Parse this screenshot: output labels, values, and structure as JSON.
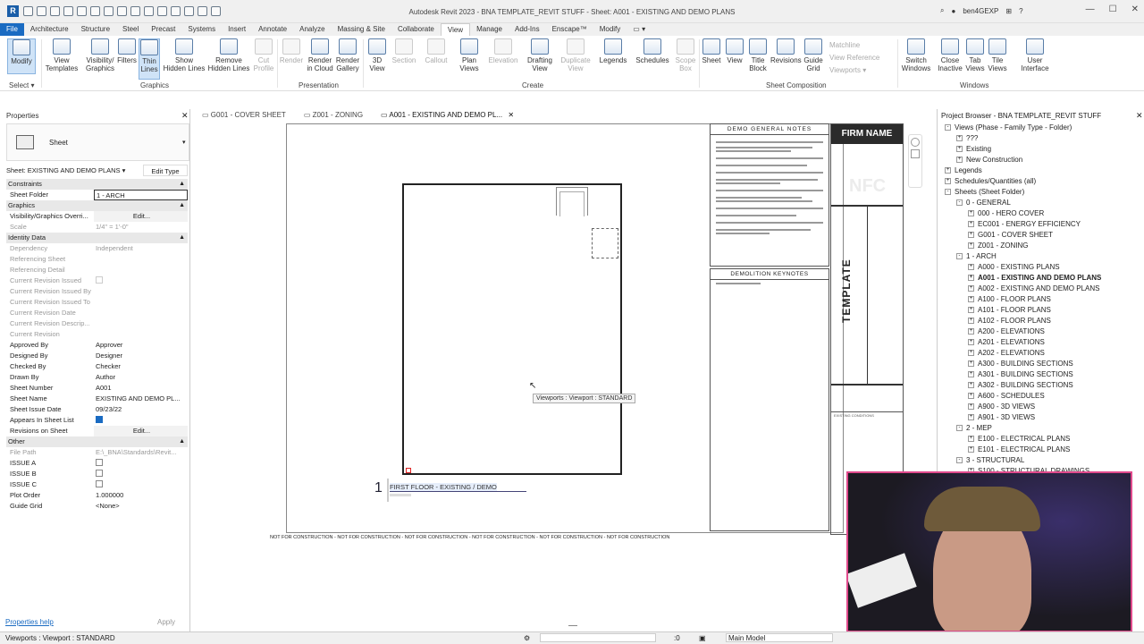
{
  "app": {
    "title": "Autodesk Revit 2023 - BNA TEMPLATE_REVIT STUFF - Sheet: A001 - EXISTING AND DEMO PLANS",
    "logo_letter": "R",
    "user": "ben4GEXP",
    "win_min": "—",
    "win_max": "☐",
    "win_close": "✕"
  },
  "ribbon_tabs": [
    "File",
    "Architecture",
    "Structure",
    "Steel",
    "Precast",
    "Systems",
    "Insert",
    "Annotate",
    "Analyze",
    "Massing & Site",
    "Collaborate",
    "View",
    "Manage",
    "Add-Ins",
    "Enscape™",
    "Modify"
  ],
  "active_tab": "View",
  "ribbon": {
    "modify": "Modify",
    "select": "Select ▾",
    "graphics_group": "Graphics",
    "presentation_group": "Presentation",
    "create_group": "Create",
    "sheet_comp_group": "Sheet Composition",
    "windows_group": "Windows",
    "buttons": [
      {
        "label": "View\nTemplates"
      },
      {
        "label": "Visibility/\nGraphics"
      },
      {
        "label": "Filters"
      },
      {
        "label": "Thin\nLines"
      },
      {
        "label": "Show\nHidden Lines"
      },
      {
        "label": "Remove\nHidden Lines"
      },
      {
        "label": "Cut\nProfile"
      },
      {
        "label": "Render"
      },
      {
        "label": "Render\nin Cloud"
      },
      {
        "label": "Render\nGallery"
      },
      {
        "label": "3D\nView"
      },
      {
        "label": "Section"
      },
      {
        "label": "Callout"
      },
      {
        "label": "Plan\nViews"
      },
      {
        "label": "Elevation"
      },
      {
        "label": "Drafting\nView"
      },
      {
        "label": "Duplicate\nView"
      },
      {
        "label": "Legends"
      },
      {
        "label": "Schedules"
      },
      {
        "label": "Scope\nBox"
      },
      {
        "label": "Sheet"
      },
      {
        "label": "View"
      },
      {
        "label": "Title\nBlock"
      },
      {
        "label": "Revisions"
      },
      {
        "label": "Guide\nGrid"
      },
      {
        "label": "Switch\nWindows"
      },
      {
        "label": "Close\nInactive"
      },
      {
        "label": "Tab\nViews"
      },
      {
        "label": "Tile\nViews"
      },
      {
        "label": "User\nInterface"
      }
    ],
    "small_items": [
      "Matchline",
      "View Reference",
      "Viewports ▾"
    ]
  },
  "properties": {
    "title": "Properties",
    "type_name": "Sheet",
    "instance_selector": "Sheet: EXISTING AND DEMO PLANS",
    "edit_type": "Edit Type",
    "sections": {
      "constraints": "Constraints",
      "graphics": "Graphics",
      "identity": "Identity Data",
      "other": "Other"
    },
    "rows": {
      "sheet_folder": {
        "k": "Sheet Folder",
        "v": "1 - ARCH"
      },
      "vg": {
        "k": "Visibility/Graphics Overri...",
        "v": "Edit..."
      },
      "scale": {
        "k": "Scale",
        "v": "1/4\" = 1'-0\""
      },
      "dependency": {
        "k": "Dependency",
        "v": "Independent"
      },
      "ref_sheet": {
        "k": "Referencing Sheet",
        "v": ""
      },
      "ref_detail": {
        "k": "Referencing Detail",
        "v": ""
      },
      "cur_rev_issued": {
        "k": "Current Revision Issued",
        "v": ""
      },
      "cur_rev_by": {
        "k": "Current Revision Issued By",
        "v": ""
      },
      "cur_rev_to": {
        "k": "Current Revision Issued To",
        "v": ""
      },
      "cur_rev_date": {
        "k": "Current Revision Date",
        "v": ""
      },
      "cur_rev_desc": {
        "k": "Current Revision Descrip...",
        "v": ""
      },
      "cur_rev": {
        "k": "Current Revision",
        "v": ""
      },
      "approved": {
        "k": "Approved By",
        "v": "Approver"
      },
      "designed": {
        "k": "Designed By",
        "v": "Designer"
      },
      "checked": {
        "k": "Checked By",
        "v": "Checker"
      },
      "drawn": {
        "k": "Drawn By",
        "v": "Author"
      },
      "sheet_number": {
        "k": "Sheet Number",
        "v": "A001"
      },
      "sheet_name": {
        "k": "Sheet Name",
        "v": "EXISTING AND DEMO PL..."
      },
      "issue_date": {
        "k": "Sheet Issue Date",
        "v": "09/23/22"
      },
      "appears": {
        "k": "Appears In Sheet List",
        "v": ""
      },
      "revisions": {
        "k": "Revisions on Sheet",
        "v": "Edit..."
      },
      "file_path": {
        "k": "File Path",
        "v": "E:\\_BNA\\Standards\\Revit..."
      },
      "issue_a": {
        "k": "ISSUE A",
        "v": ""
      },
      "issue_b": {
        "k": "ISSUE B",
        "v": ""
      },
      "issue_c": {
        "k": "ISSUE C",
        "v": ""
      },
      "plot_order": {
        "k": "Plot Order",
        "v": "1.000000"
      },
      "guide_grid": {
        "k": "Guide Grid",
        "v": "<None>"
      }
    },
    "help_link": "Properties help",
    "apply": "Apply"
  },
  "doc_tabs": [
    {
      "label": "G001 - COVER SHEET"
    },
    {
      "label": "Z001 - ZONING"
    },
    {
      "label": "A001 - EXISTING AND DEMO PL..."
    }
  ],
  "sheet": {
    "demo_notes_title": "DEMO GENERAL NOTES",
    "demo_keynotes_title": "DEMOLITION KEYNOTES",
    "firm_name": "FIRM NAME",
    "nfc": "NFC",
    "template": "TEMPLATE",
    "view_number": "1",
    "view_title": "FIRST FLOOR - EXISTING / DEMO",
    "tooltip": "Viewports : Viewport : STANDARD",
    "not_for_construction": "NOT FOR CONSTRUCTION  -  NOT FOR CONSTRUCTION  -  NOT FOR CONSTRUCTION  -  NOT FOR CONSTRUCTION  -  NOT FOR CONSTRUCTION  -  NOT FOR CONSTRUCTION",
    "existing_conditions": "EXISTING CONDITIONS"
  },
  "browser": {
    "title": "Project Browser - BNA TEMPLATE_REVIT STUFF",
    "items": [
      {
        "label": "Views (Phase - Family Type - Folder)",
        "indent": 0,
        "exp": "-"
      },
      {
        "label": "???",
        "indent": 1,
        "exp": "+"
      },
      {
        "label": "Existing",
        "indent": 1,
        "exp": "+"
      },
      {
        "label": "New Construction",
        "indent": 1,
        "exp": "+"
      },
      {
        "label": "Legends",
        "indent": 0,
        "exp": "+"
      },
      {
        "label": "Schedules/Quantities (all)",
        "indent": 0,
        "exp": "+"
      },
      {
        "label": "Sheets (Sheet Folder)",
        "indent": 0,
        "exp": "-"
      },
      {
        "label": "0 - GENERAL",
        "indent": 1,
        "exp": "-"
      },
      {
        "label": "000 - HERO COVER",
        "indent": 2,
        "exp": "+"
      },
      {
        "label": "EC001 - ENERGY EFFICIENCY",
        "indent": 2,
        "exp": "+"
      },
      {
        "label": "G001 - COVER SHEET",
        "indent": 2,
        "exp": "+"
      },
      {
        "label": "Z001 - ZONING",
        "indent": 2,
        "exp": "+"
      },
      {
        "label": "1 - ARCH",
        "indent": 1,
        "exp": "-"
      },
      {
        "label": "A000 - EXISTING PLANS",
        "indent": 2,
        "exp": "+"
      },
      {
        "label": "A001 - EXISTING AND DEMO PLANS",
        "indent": 2,
        "exp": "+",
        "bold": true
      },
      {
        "label": "A002 - EXISTING AND DEMO PLANS",
        "indent": 2,
        "exp": "+"
      },
      {
        "label": "A100 - FLOOR PLANS",
        "indent": 2,
        "exp": "+"
      },
      {
        "label": "A101 - FLOOR PLANS",
        "indent": 2,
        "exp": "+"
      },
      {
        "label": "A102 - FLOOR PLANS",
        "indent": 2,
        "exp": "+"
      },
      {
        "label": "A200 - ELEVATIONS",
        "indent": 2,
        "exp": "+"
      },
      {
        "label": "A201 - ELEVATIONS",
        "indent": 2,
        "exp": "+"
      },
      {
        "label": "A202 - ELEVATIONS",
        "indent": 2,
        "exp": "+"
      },
      {
        "label": "A300 - BUILDING SECTIONS",
        "indent": 2,
        "exp": "+"
      },
      {
        "label": "A301 - BUILDING SECTIONS",
        "indent": 2,
        "exp": "+"
      },
      {
        "label": "A302 - BUILDING SECTIONS",
        "indent": 2,
        "exp": "+"
      },
      {
        "label": "A600 - SCHEDULES",
        "indent": 2,
        "exp": "+"
      },
      {
        "label": "A900 - 3D VIEWS",
        "indent": 2,
        "exp": "+"
      },
      {
        "label": "A901 - 3D VIEWS",
        "indent": 2,
        "exp": "+"
      },
      {
        "label": "2 - MEP",
        "indent": 1,
        "exp": "-"
      },
      {
        "label": "E100 - ELECTRICAL PLANS",
        "indent": 2,
        "exp": "+"
      },
      {
        "label": "E101 - ELECTRICAL PLANS",
        "indent": 2,
        "exp": "+"
      },
      {
        "label": "3 - STRUCTURAL",
        "indent": 1,
        "exp": "-"
      },
      {
        "label": "S100 - STRUCTURAL DRAWINGS",
        "indent": 2,
        "exp": "+"
      }
    ]
  },
  "status": {
    "left": "Viewports : Viewport : STANDARD",
    "zero": ":0",
    "model": "Main Model"
  }
}
